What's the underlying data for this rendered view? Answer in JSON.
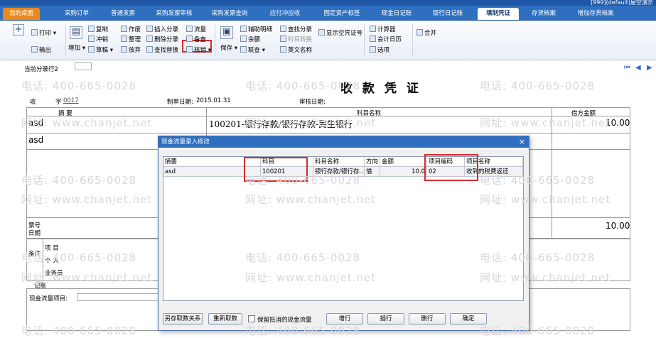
{
  "window": {
    "top_info": "[999](default)屋空演示"
  },
  "tabs": [
    "我的桌面",
    "采购订单",
    "普通发票",
    "采购发票审核",
    "采购发票查询",
    "应付冲应收",
    "固定资产标签",
    "现金日记账",
    "银行日记账",
    "填制凭证",
    "存货档案",
    "增加存货档案"
  ],
  "active_tab": "填制凭证",
  "toolbar": {
    "add": "+",
    "print": "打印",
    "export": "输出",
    "add_btn": "增加",
    "copy": "复制",
    "reverse": "冲销",
    "draft": "草稿",
    "void": "作废",
    "tidy": "整理",
    "abandon": "放弃",
    "insert_entry": "插入分录",
    "delete_entry": "删除分录",
    "find_replace": "查找替换",
    "cashflow": "流量",
    "check": "备查",
    "checkout": "核销",
    "save": "保存",
    "aux_detail": "辅助明细",
    "balance": "余额",
    "link_query": "联查",
    "find_entry": "查找分录",
    "subject_convert": "科目转换",
    "english_name": "英文名称",
    "show_void_no": "显示空凭证号",
    "calculator": "计算器",
    "accounting_calendar": "会计日历",
    "options": "选项",
    "merge": "合并"
  },
  "voucher": {
    "current_entry_label": "当前分录行2",
    "title": "收 款 凭 证",
    "type_label": "收",
    "word_label": "字",
    "number": "0017",
    "date_label": "制单日期:",
    "date": "2015.01.31",
    "audit_date_label": "审核日期:",
    "col_summary": "摘 要",
    "col_subject": "科目名称",
    "col_debit": "借方金额",
    "rows": [
      {
        "summary": "asd",
        "subject": "100201-银行存款/银行存款-民生银行",
        "debit": "10.00"
      },
      {
        "summary": "asd",
        "subject": "",
        "debit": ""
      }
    ],
    "ticket_no": "票号",
    "date_field": "日期",
    "total": "10.00",
    "remark": "备注",
    "project": "项 目",
    "individual": "个 人",
    "salesman": "业务员",
    "bookkeeping": "记账",
    "cashflow_project_label": "现金流量项目:"
  },
  "dialog": {
    "title": "现金流量录入修改",
    "close": "×",
    "headers": [
      "摘要",
      "科目",
      "科目名称",
      "方向",
      "金额",
      "项目编码",
      "项目名称"
    ],
    "row": {
      "summary": "asd",
      "subject": "100201",
      "subject_name": "银行存款/银行存...",
      "direction": "借",
      "amount": "10.0",
      "project_code": "02",
      "project_name": "收到的税费返还"
    },
    "buttons": {
      "save_relation": "另存取数关系",
      "refetch": "重新取数",
      "keep_checkbox": "保留抵消的现金流量",
      "add_row": "增行",
      "insert_row": "插行",
      "delete_row": "删行",
      "confirm": "确定"
    }
  },
  "watermark": {
    "phone": "电话: 400-665-0028",
    "site": "网址: www.chanjet.net"
  }
}
